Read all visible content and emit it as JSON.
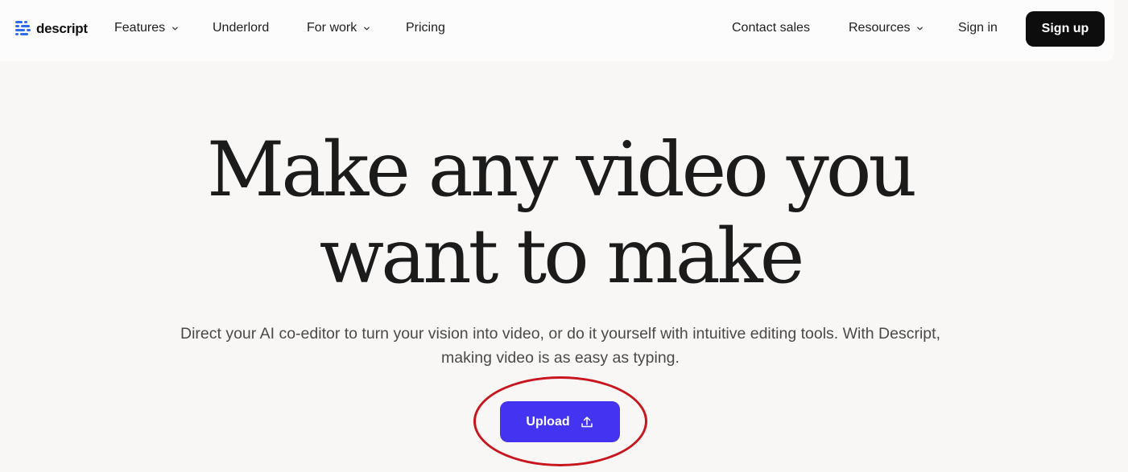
{
  "nav": {
    "brand": "descript",
    "items": [
      {
        "label": "Features",
        "has_dropdown": true
      },
      {
        "label": "Underlord",
        "has_dropdown": false
      },
      {
        "label": "For work",
        "has_dropdown": true
      },
      {
        "label": "Pricing",
        "has_dropdown": false
      }
    ],
    "right_items": [
      {
        "label": "Contact sales",
        "has_dropdown": false
      },
      {
        "label": "Resources",
        "has_dropdown": true
      },
      {
        "label": "Sign in",
        "has_dropdown": false
      }
    ],
    "signup_label": "Sign up"
  },
  "hero": {
    "title_line1": "Make any video you",
    "title_line2": "want to make",
    "subtitle": "Direct your AI co-editor to turn your vision into video, or do it yourself with intuitive editing tools. With Descript, making video is as easy as typing.",
    "upload_label": "Upload",
    "upload_icon": "upload-icon"
  },
  "colors": {
    "brand_accent": "#4433f0",
    "logo_blue": "#2f6bf0",
    "signup_bg": "#0d0d0d",
    "annotation": "#c8161e",
    "page_bg": "#f8f7f5"
  }
}
